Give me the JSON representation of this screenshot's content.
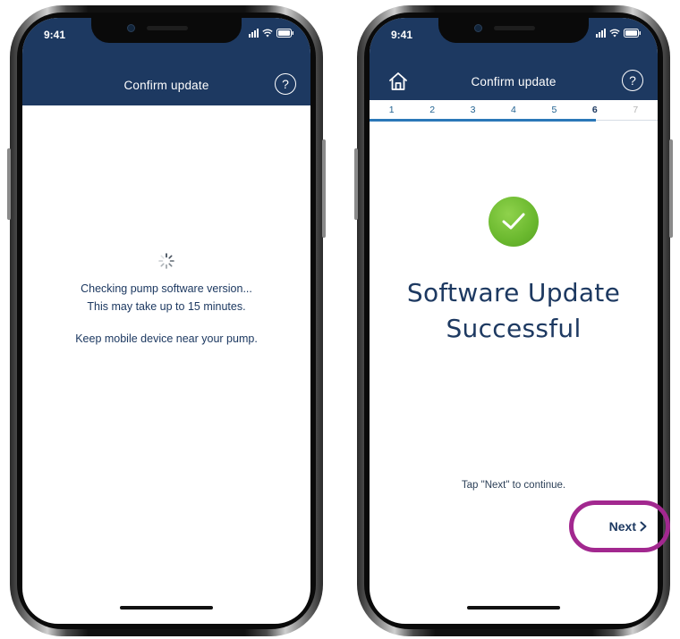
{
  "status_bar": {
    "time": "9:41"
  },
  "left_screen": {
    "header_title": "Confirm update",
    "help_label": "?",
    "message_line1": "Checking pump software version...",
    "message_line2": "This may take up to 15 minutes.",
    "message_line3": "Keep mobile device near your pump."
  },
  "right_screen": {
    "header_title": "Confirm update",
    "help_label": "?",
    "steps": [
      "1",
      "2",
      "3",
      "4",
      "5",
      "6",
      "7"
    ],
    "current_step": 6,
    "success_line1": "Software Update",
    "success_line2": "Successful",
    "hint": "Tap \"Next\" to continue.",
    "next_label": "Next"
  },
  "colors": {
    "header_navy": "#1d3961",
    "success_green": "#6ab82e",
    "callout_magenta": "#a2288f",
    "progress_blue": "#2b78b8"
  },
  "icons": [
    "home-icon",
    "help-icon",
    "spinner-icon",
    "check-icon",
    "chevron-right-icon",
    "wifi-icon",
    "battery-icon",
    "signal-icon"
  ]
}
